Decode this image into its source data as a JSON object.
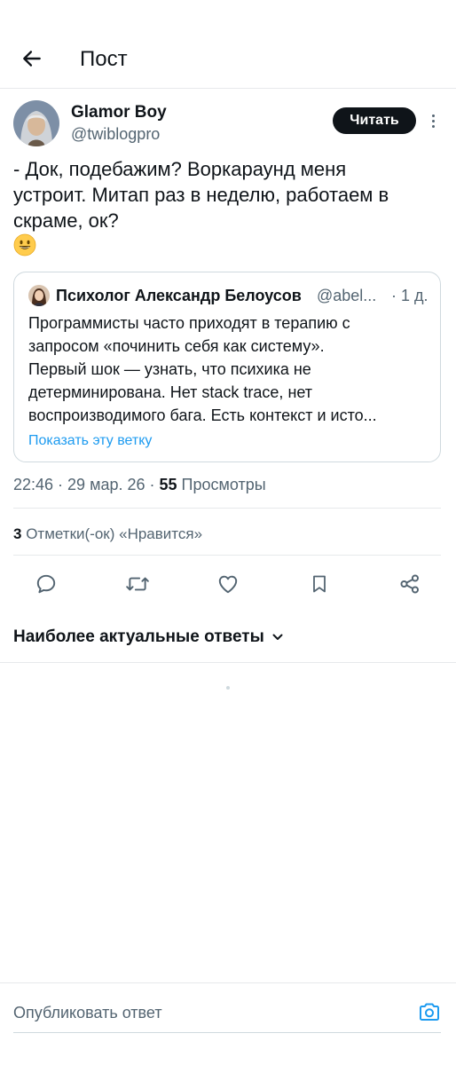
{
  "header": {
    "title": "Пост"
  },
  "tweet": {
    "author_name": "Glamor Boy",
    "author_handle": "@twiblogpro",
    "follow_button": "Читать",
    "text": "- Док, подебажим? Воркараунд меня\nустроит. Митап раз в неделю, работаем в\nскраме, ок?",
    "emoji": "😀",
    "time": "22:46",
    "date": "29 мар. 26",
    "views_count": "55",
    "views_label": "Просмотры",
    "likes_count": "3",
    "likes_label": "Отметки(-ок) «Нравится»"
  },
  "quote": {
    "author_name": "Психолог Александр Белоусов",
    "author_handle": "@abel...",
    "time": "· 1 д.",
    "lines": [
      "Программисты часто приходят в терапию с",
      "запросом «починить себя как систему».",
      "Первый шок — узнать, что психика не",
      "детерминирована. Нет stack trace, нет",
      "воспроизводимого бага. Есть контекст и исто..."
    ],
    "show_thread": "Показать эту ветку"
  },
  "actions": [
    "reply-icon",
    "retweet-icon",
    "like-icon",
    "bookmark-icon",
    "share-icon"
  ],
  "replies": {
    "sort_label": "Наиболее актуальные ответы"
  },
  "composer": {
    "placeholder": "Опубликовать ответ"
  },
  "colors": {
    "text": "#0f1419",
    "secondary": "#536471",
    "link": "#1d9bf0",
    "border": "#e7e9eb"
  }
}
